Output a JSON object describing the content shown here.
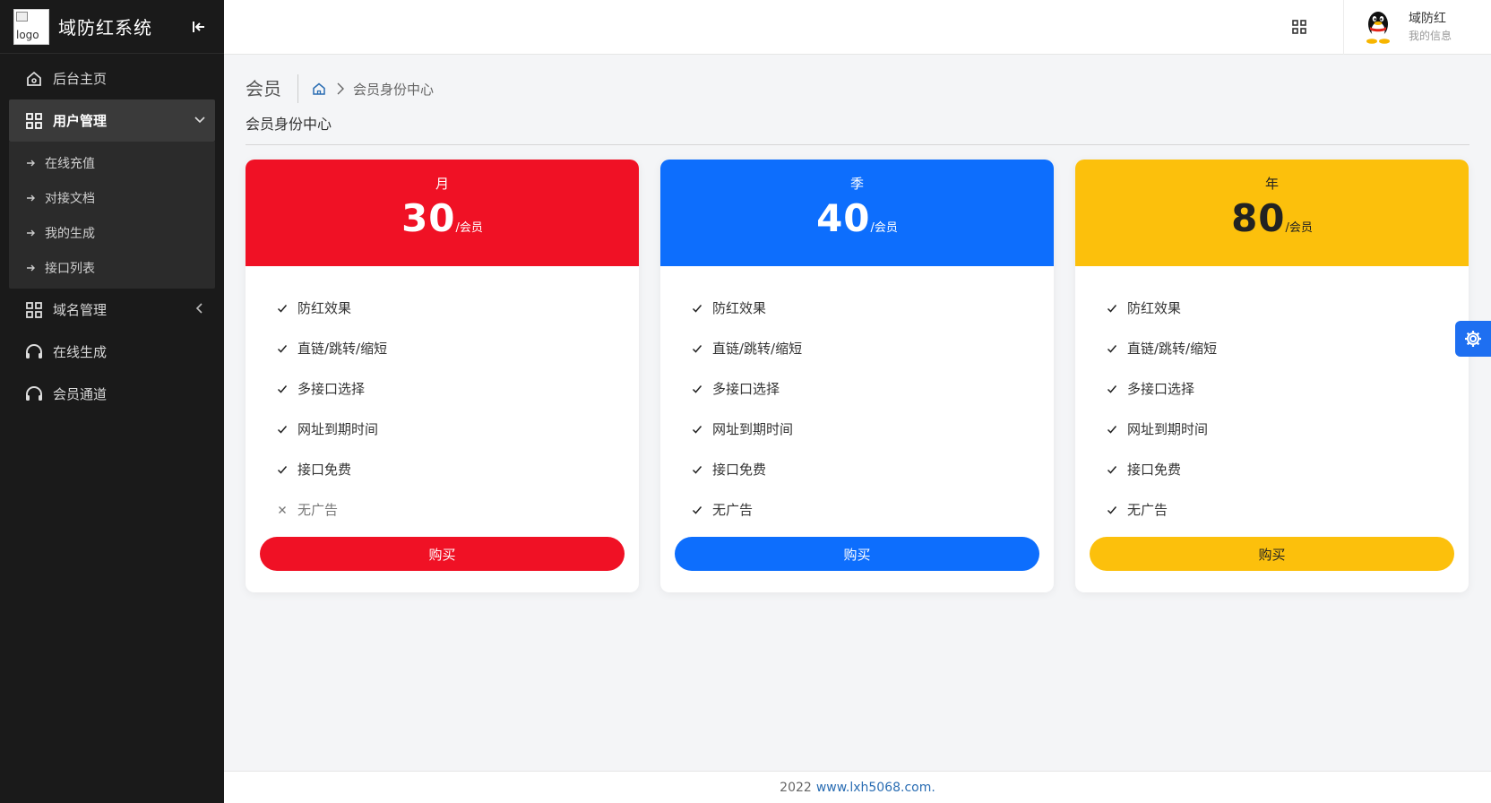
{
  "brand": {
    "logo_alt": "logo",
    "title": "域防红系统"
  },
  "sidebar": {
    "items": [
      {
        "label": "后台主页",
        "icon": "home-icon"
      },
      {
        "label": "用户管理",
        "icon": "grid-icon",
        "expanded": true,
        "children": [
          "在线充值",
          "对接文档",
          "我的生成",
          "接口列表"
        ]
      },
      {
        "label": "域名管理",
        "icon": "grid-icon"
      },
      {
        "label": "在线生成",
        "icon": "headset-icon"
      },
      {
        "label": "会员通道",
        "icon": "headset-icon"
      }
    ]
  },
  "header": {
    "user_name": "域防红",
    "user_info": "我的信息"
  },
  "breadcrumb": {
    "title": "会员",
    "current": "会员身份中心"
  },
  "page": {
    "subtitle": "会员身份中心"
  },
  "plans": [
    {
      "period": "月",
      "price": "30",
      "unit": "/会员",
      "color": "#f01125",
      "button": "购买",
      "features": [
        {
          "text": "防红效果",
          "included": true
        },
        {
          "text": "直链/跳转/缩短",
          "included": true
        },
        {
          "text": "多接口选择",
          "included": true
        },
        {
          "text": "网址到期时间",
          "included": true
        },
        {
          "text": "接口免费",
          "included": true
        },
        {
          "text": "无广告",
          "included": false
        }
      ]
    },
    {
      "period": "季",
      "price": "40",
      "unit": "/会员",
      "color": "#0d6efd",
      "button": "购买",
      "features": [
        {
          "text": "防红效果",
          "included": true
        },
        {
          "text": "直链/跳转/缩短",
          "included": true
        },
        {
          "text": "多接口选择",
          "included": true
        },
        {
          "text": "网址到期时间",
          "included": true
        },
        {
          "text": "接口免费",
          "included": true
        },
        {
          "text": "无广告",
          "included": true
        }
      ]
    },
    {
      "period": "年",
      "price": "80",
      "unit": "/会员",
      "color": "#fcc00c",
      "button": "购买",
      "features": [
        {
          "text": "防红效果",
          "included": true
        },
        {
          "text": "直链/跳转/缩短",
          "included": true
        },
        {
          "text": "多接口选择",
          "included": true
        },
        {
          "text": "网址到期时间",
          "included": true
        },
        {
          "text": "接口免费",
          "included": true
        },
        {
          "text": "无广告",
          "included": true
        }
      ]
    }
  ],
  "footer": {
    "year": "2022",
    "link": "www.lxh5068.com."
  }
}
